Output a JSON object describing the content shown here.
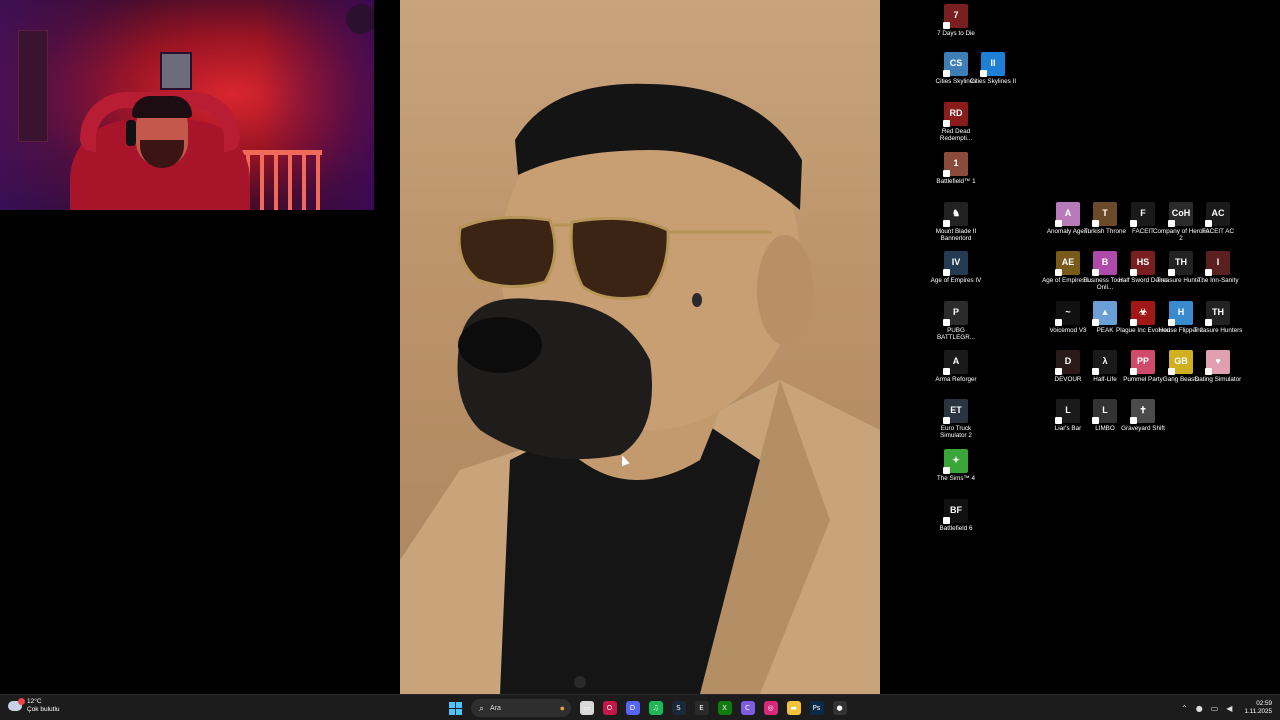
{
  "desktop": {
    "icons": [
      {
        "label": "7 Days to Die",
        "color": "#7a1f1f",
        "glyph": "7"
      },
      {
        "label": "Cities Skylines",
        "color": "#3f7fb8",
        "glyph": "CS"
      },
      {
        "label": "Cities Skylines II",
        "color": "#1e7fd6",
        "glyph": "II"
      },
      {
        "label": "Red Dead Redempti...",
        "color": "#8a1b1b",
        "glyph": "RD"
      },
      {
        "label": "Battlefield™ 1",
        "color": "#8a4b3a",
        "glyph": "1"
      },
      {
        "label": "Mount  Blade II Bannerlord",
        "color": "#222222",
        "glyph": "♞"
      },
      {
        "label": "Age of Empires IV",
        "color": "#233a52",
        "glyph": "IV"
      },
      {
        "label": "PUBG BATTLEGR...",
        "color": "#2b2b2b",
        "glyph": "P"
      },
      {
        "label": "Arma Reforger",
        "color": "#1a1a1a",
        "glyph": "A"
      },
      {
        "label": "Euro Truck Simulator 2",
        "color": "#2a3440",
        "glyph": "ET"
      },
      {
        "label": "The Sims™ 4",
        "color": "#3aa63a",
        "glyph": "✦"
      },
      {
        "label": "Battlefield 6",
        "color": "#111111",
        "glyph": "BF"
      },
      {
        "label": "Anomaly Agent",
        "color": "#b87ab8",
        "glyph": "A"
      },
      {
        "label": "Turkish Throne",
        "color": "#6b4a2a",
        "glyph": "T"
      },
      {
        "label": "FACEIT",
        "color": "#1a1a1a",
        "glyph": "F"
      },
      {
        "label": "Company of Heroes 2",
        "color": "#2a2a2a",
        "glyph": "CoH"
      },
      {
        "label": "FACEIT AC",
        "color": "#1a1a1a",
        "glyph": "AC"
      },
      {
        "label": "Age of Empires I...",
        "color": "#7a5a1a",
        "glyph": "AE"
      },
      {
        "label": "Business Tour - Onli...",
        "color": "#b04aa8",
        "glyph": "B"
      },
      {
        "label": "Half Sword Demo",
        "color": "#7a1f1f",
        "glyph": "HS"
      },
      {
        "label": "Treasure Hunte...",
        "color": "#222222",
        "glyph": "TH"
      },
      {
        "label": "The Inn-Sanity",
        "color": "#5a1f1f",
        "glyph": "I"
      },
      {
        "label": "Voicemod V3",
        "color": "#111111",
        "glyph": "~"
      },
      {
        "label": "PEAK",
        "color": "#6aa0d6",
        "glyph": "▲"
      },
      {
        "label": "Plague Inc Evolved",
        "color": "#a01818",
        "glyph": "☣"
      },
      {
        "label": "House Flipper 2",
        "color": "#3a8ad0",
        "glyph": "H"
      },
      {
        "label": "Treasure Hunters",
        "color": "#222222",
        "glyph": "TH"
      },
      {
        "label": "DEVOUR",
        "color": "#2a1a1a",
        "glyph": "D"
      },
      {
        "label": "Half-Life",
        "color": "#1a1a1a",
        "glyph": "λ"
      },
      {
        "label": "Pummel Party",
        "color": "#d04a6a",
        "glyph": "PP"
      },
      {
        "label": "Gang Beasts",
        "color": "#d0b020",
        "glyph": "GB"
      },
      {
        "label": "Dating Simulator",
        "color": "#e0a0b0",
        "glyph": "♥"
      },
      {
        "label": "Liar's Bar",
        "color": "#1a1a1a",
        "glyph": "L"
      },
      {
        "label": "LIMBO",
        "color": "#333333",
        "glyph": "L"
      },
      {
        "label": "Graveyard Shift",
        "color": "#4a4a4a",
        "glyph": "✝"
      }
    ]
  },
  "taskbar": {
    "weather": {
      "temp": "12°C",
      "condition": "Çok bulutlu"
    },
    "search_placeholder": "Ara",
    "clock": {
      "time": "02:59",
      "date": "1.11.2025"
    },
    "apps": [
      {
        "name": "file-explorer-view",
        "color": "#d9d9d9",
        "glyph": "▭"
      },
      {
        "name": "opera-gx",
        "color": "#c4184a",
        "glyph": "O"
      },
      {
        "name": "discord",
        "color": "#5865f2",
        "glyph": "D"
      },
      {
        "name": "spotify",
        "color": "#1db954",
        "glyph": "♫"
      },
      {
        "name": "steam",
        "color": "#1b2838",
        "glyph": "S"
      },
      {
        "name": "epic-games",
        "color": "#2a2a2a",
        "glyph": "E"
      },
      {
        "name": "xbox",
        "color": "#107c10",
        "glyph": "X"
      },
      {
        "name": "copilot",
        "color": "#7b5de0",
        "glyph": "C"
      },
      {
        "name": "instagram",
        "color": "#d6297a",
        "glyph": "◎"
      },
      {
        "name": "folder",
        "color": "#f3c13a",
        "glyph": "▬"
      },
      {
        "name": "photoshop",
        "color": "#0b2a4a",
        "glyph": "Ps"
      },
      {
        "name": "obs",
        "color": "#333333",
        "glyph": "●"
      }
    ]
  }
}
